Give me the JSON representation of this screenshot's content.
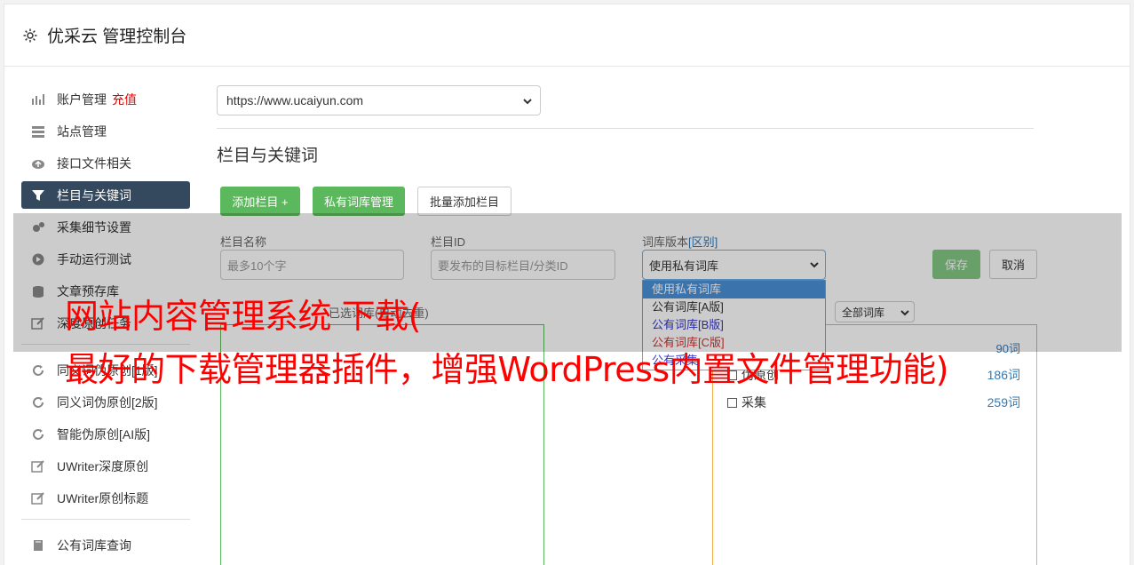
{
  "header": {
    "title": "优采云 管理控制台"
  },
  "sidebar": {
    "items": [
      {
        "label": "账户管理",
        "extra": "充值",
        "icon": "bar-chart-icon"
      },
      {
        "label": "站点管理",
        "icon": "server-icon"
      },
      {
        "label": "接口文件相关",
        "icon": "cloud-upload-icon"
      },
      {
        "label": "栏目与关键词",
        "icon": "filter-icon",
        "active": true
      },
      {
        "label": "采集细节设置",
        "icon": "gears-icon"
      },
      {
        "label": "手动运行测试",
        "icon": "play-icon"
      },
      {
        "label": "文章预存库",
        "icon": "database-icon"
      },
      {
        "label": "深度原创任务",
        "icon": "edit-icon"
      }
    ],
    "items2": [
      {
        "label": "同义词伪原创[1版]",
        "icon": "refresh-icon"
      },
      {
        "label": "同义词伪原创[2版]",
        "icon": "refresh-icon"
      },
      {
        "label": "智能伪原创[AI版]",
        "icon": "refresh-icon"
      },
      {
        "label": "UWriter深度原创",
        "icon": "edit-icon"
      },
      {
        "label": "UWriter原创标题",
        "icon": "edit-icon"
      }
    ],
    "items3": [
      {
        "label": "公有词库查询",
        "icon": "book-icon"
      }
    ]
  },
  "main": {
    "site_select": "https://www.ucaiyun.com",
    "section_title": "栏目与关键词",
    "buttons": {
      "add_column": "添加栏目 +",
      "private_lib": "私有词库管理",
      "batch_add": "批量添加栏目"
    },
    "form": {
      "name_label": "栏目名称",
      "name_placeholder": "最多10个字",
      "id_label": "栏目ID",
      "id_placeholder": "要发布的目标栏目/分类ID",
      "lib_label": "词库版本",
      "lib_label_link": "[区别]",
      "lib_value": "使用私有词库",
      "save": "保存",
      "cancel": "取消"
    },
    "dropdown_options": [
      "使用私有词库",
      "公有词库[A版]",
      "公有词库[B版]",
      "公有词库[C版]",
      "公有采集"
    ],
    "filter_select": "全部词库",
    "dedup_label": "已选词库(自动去重)",
    "lib_list": [
      {
        "name": "伪原创",
        "count": "186词"
      },
      {
        "name": "采集",
        "count": "259词"
      }
    ],
    "partial_count": "90词"
  },
  "banner": {
    "line1": "网站内容管理系统 下载(",
    "line2": "最好的下载管理器插件，增强WordPress内置文件管理功能)"
  },
  "colors": {
    "accent_green": "#5cb85c",
    "active_nav": "#34495e",
    "banner_red": "#ff0000"
  }
}
